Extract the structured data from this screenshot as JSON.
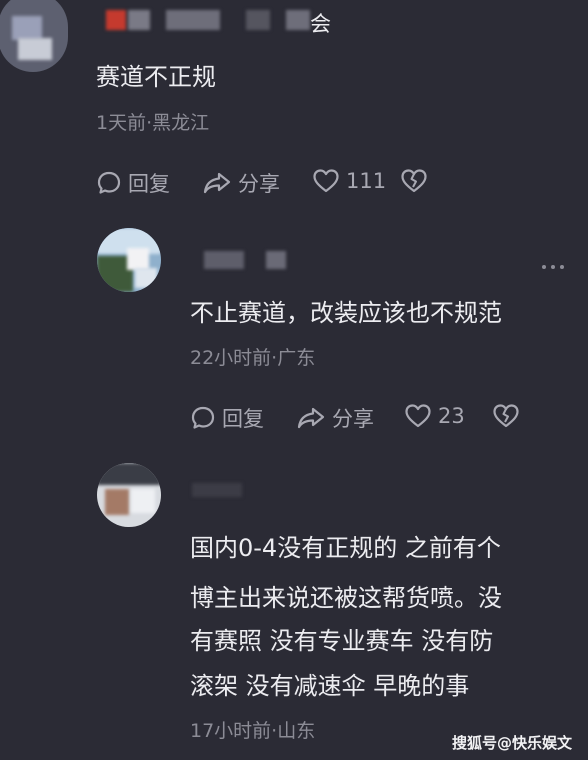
{
  "comments": [
    {
      "username_visible_fragment": "会",
      "text": "赛道不正规",
      "meta": "1天前·黑龙江",
      "reply_label": "回复",
      "share_label": "分享",
      "like_count": "111"
    },
    {
      "text": "不止赛道，改装应该也不规范",
      "meta": "22小时前·广东",
      "reply_label": "回复",
      "share_label": "分享",
      "like_count": "23"
    },
    {
      "text_lines": [
        "国内0-4没有正规的 之前有个",
        "博主出来说还被这帮货喷。没",
        "有赛照 没有专业赛车 没有防",
        "滚架 没有减速伞 早晚的事"
      ],
      "meta": "17小时前·山东"
    }
  ],
  "watermark": "搜狐号@快乐娱文",
  "icons": [
    "comment-icon",
    "share-icon",
    "heart-icon",
    "broken-heart-icon",
    "more-icon"
  ],
  "colors": {
    "background": "#2b2b35",
    "text": "#ececf0",
    "meta": "#8c8c96",
    "action": "#a8a8b2"
  }
}
